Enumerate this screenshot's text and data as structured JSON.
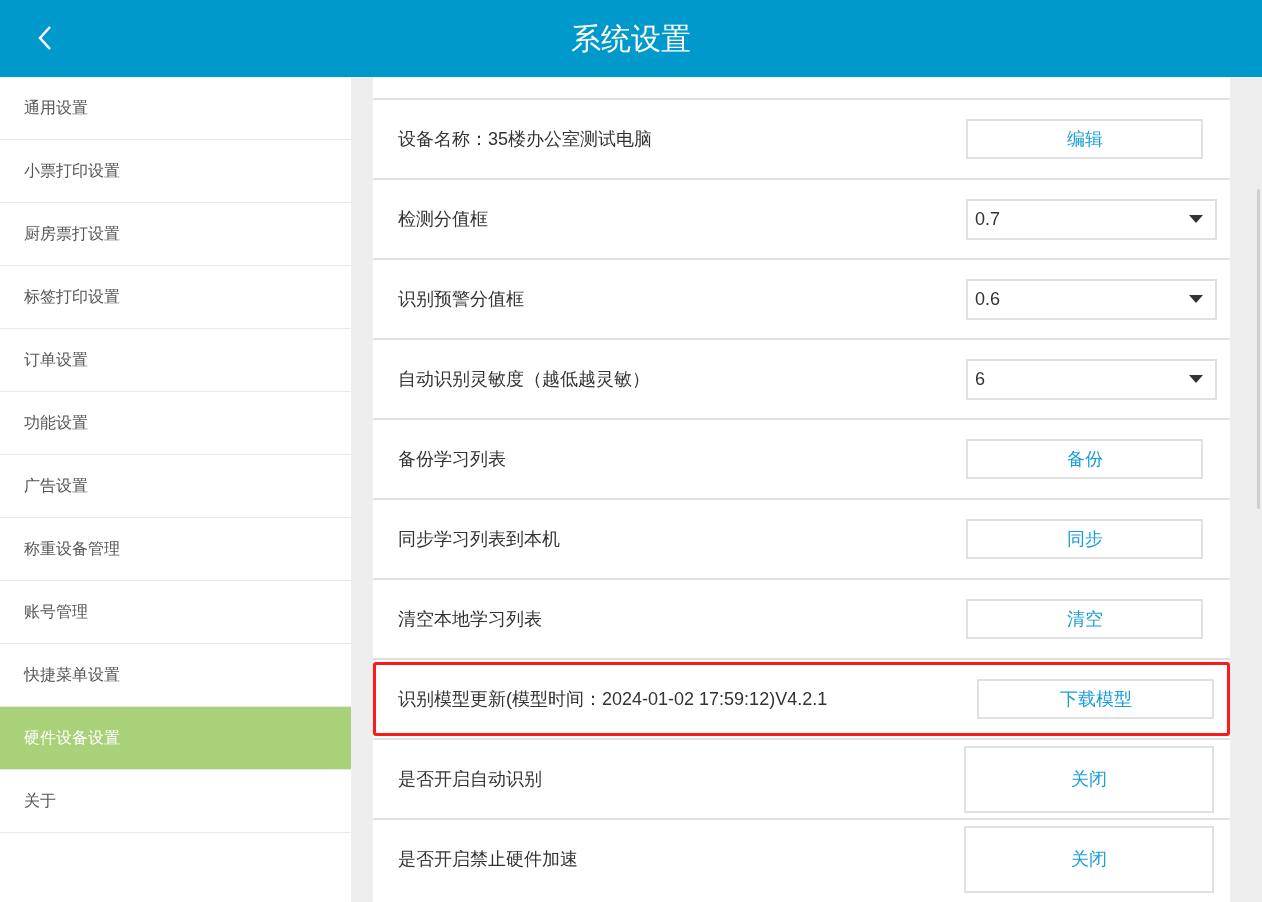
{
  "header": {
    "title": "系统设置"
  },
  "sidebar": {
    "items": [
      {
        "label": "通用设置",
        "selected": false
      },
      {
        "label": "小票打印设置",
        "selected": false
      },
      {
        "label": "厨房票打设置",
        "selected": false
      },
      {
        "label": "标签打印设置",
        "selected": false
      },
      {
        "label": "订单设置",
        "selected": false
      },
      {
        "label": "功能设置",
        "selected": false
      },
      {
        "label": "广告设置",
        "selected": false
      },
      {
        "label": "称重设备管理",
        "selected": false
      },
      {
        "label": "账号管理",
        "selected": false
      },
      {
        "label": "快捷菜单设置",
        "selected": false
      },
      {
        "label": "硬件设备设置",
        "selected": true
      },
      {
        "label": "关于",
        "selected": false
      }
    ]
  },
  "settings": [
    {
      "kind": "button",
      "label": "设备名称：35楼办公室测试电脑",
      "action": "编辑",
      "highlighted": false
    },
    {
      "kind": "select",
      "label": "检测分值框",
      "value": "0.7",
      "highlighted": false
    },
    {
      "kind": "select",
      "label": "识别预警分值框",
      "value": "0.6",
      "highlighted": false
    },
    {
      "kind": "select",
      "label": "自动识别灵敏度（越低越灵敏）",
      "value": "6",
      "highlighted": false
    },
    {
      "kind": "button",
      "label": "备份学习列表",
      "action": "备份",
      "highlighted": false
    },
    {
      "kind": "button",
      "label": "同步学习列表到本机",
      "action": "同步",
      "highlighted": false
    },
    {
      "kind": "button",
      "label": "清空本地学习列表",
      "action": "清空",
      "highlighted": false
    },
    {
      "kind": "button",
      "label": "识别模型更新(模型时间：2024-01-02 17:59:12)V4.2.1",
      "action": "下载模型",
      "highlighted": true
    },
    {
      "kind": "toggle",
      "label": "是否开启自动识别",
      "action": "关闭",
      "highlighted": false
    },
    {
      "kind": "toggle",
      "label": "是否开启禁止硬件加速",
      "action": "关闭",
      "highlighted": false
    }
  ]
}
